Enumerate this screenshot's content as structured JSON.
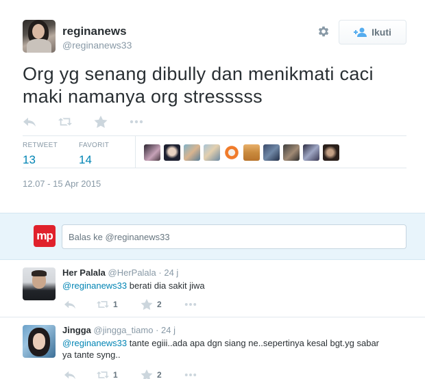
{
  "tweet": {
    "display_name": "reginanews",
    "screen_name": "@reginanews33",
    "follow_label": "Ikuti",
    "text": "Org yg senang dibully dan menikmati caci maki namanya org stresssss",
    "stats": {
      "retweet_label": "RETWEET",
      "retweet_count": "13",
      "favorite_label": "FAVORIT",
      "favorite_count": "14"
    },
    "timestamp": "12.07 - 15 Apr 2015"
  },
  "reply_box": {
    "logo_text": "mp",
    "placeholder": "Balas ke @reginanews33"
  },
  "replies": [
    {
      "name": "Her Palala",
      "handle": "@HerPalala",
      "time": "· 24 j",
      "mention": "@reginanews33",
      "text": " berati dia sakit jiwa",
      "retweets": "1",
      "favorites": "2"
    },
    {
      "name": "Jingga",
      "handle": "@jingga_tiamo",
      "time": "· 24 j",
      "mention": "@reginanews33",
      "text": " tante egiii..ada apa dgn siang ne..sepertinya kesal bgt.yg sabar ya tante syng..",
      "retweets": "1",
      "favorites": "2"
    }
  ],
  "icons": [
    "gear-icon",
    "add-user-icon",
    "reply-icon",
    "retweet-icon",
    "favorite-star-icon",
    "more-icon"
  ],
  "colors": {
    "link": "#0084b4",
    "muted": "#8899a6",
    "reply_bg": "#e8f4fb",
    "brand_red": "#e0212b"
  }
}
